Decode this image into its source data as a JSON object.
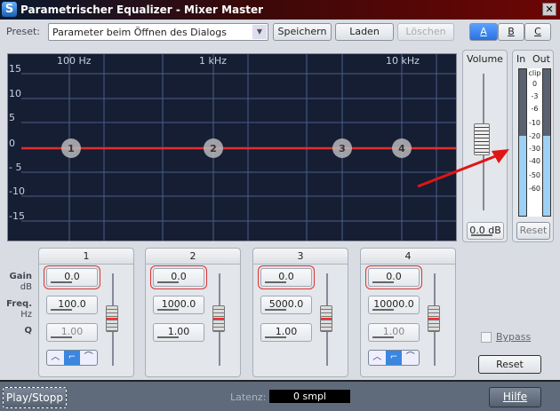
{
  "window": {
    "title": "Parametrischer Equalizer - Mixer Master",
    "logo": "S",
    "close_icon": "close-icon"
  },
  "preset": {
    "label": "Preset:",
    "value": "Parameter beim Öffnen des Dialogs",
    "save": "Speichern",
    "load": "Laden",
    "delete": "Löschen"
  },
  "abc": [
    "A",
    "B",
    "C"
  ],
  "graph": {
    "freq_labels": [
      "100 Hz",
      "1 kHz",
      "10 kHz"
    ],
    "gain_labels": [
      "15",
      "10",
      "5",
      "0",
      "- 5",
      "-10",
      "-15"
    ],
    "nodes": [
      "1",
      "2",
      "3",
      "4"
    ],
    "curve_color": "#e03030"
  },
  "volume": {
    "title": "Volume",
    "value": "0.0 dB",
    "level_db": 0
  },
  "meter": {
    "in": "In",
    "out": "Out",
    "scale": [
      "clip",
      "0",
      "-3",
      "-6",
      "-10",
      "-20",
      "-30",
      "-40",
      "-50",
      "-60"
    ],
    "in_level_db": -20,
    "out_level_db": -20,
    "reset": "Reset"
  },
  "labels": {
    "gain": "Gain",
    "gain_unit": "dB",
    "freq": "Freq.",
    "freq_unit": "Hz",
    "q": "Q"
  },
  "bands": [
    {
      "name": "1",
      "gain": "0.0",
      "freq": "100.0",
      "q": "1.00",
      "filter": [
        "peak",
        "low-shelf",
        "high-pass"
      ],
      "active": 1
    },
    {
      "name": "2",
      "gain": "0.0",
      "freq": "1000.0",
      "q": "1.00"
    },
    {
      "name": "3",
      "gain": "0.0",
      "freq": "5000.0",
      "q": "1.00"
    },
    {
      "name": "4",
      "gain": "0.0",
      "freq": "10000.0",
      "q": "1.00",
      "filter": [
        "peak",
        "high-shelf",
        "low-pass"
      ],
      "active": 1
    }
  ],
  "bypass": "Bypass",
  "reset": "Reset",
  "bottom": {
    "play": "Play/Stopp",
    "latency_label": "Latenz:",
    "latency_value": "0 smpl",
    "help": "Hilfe"
  }
}
